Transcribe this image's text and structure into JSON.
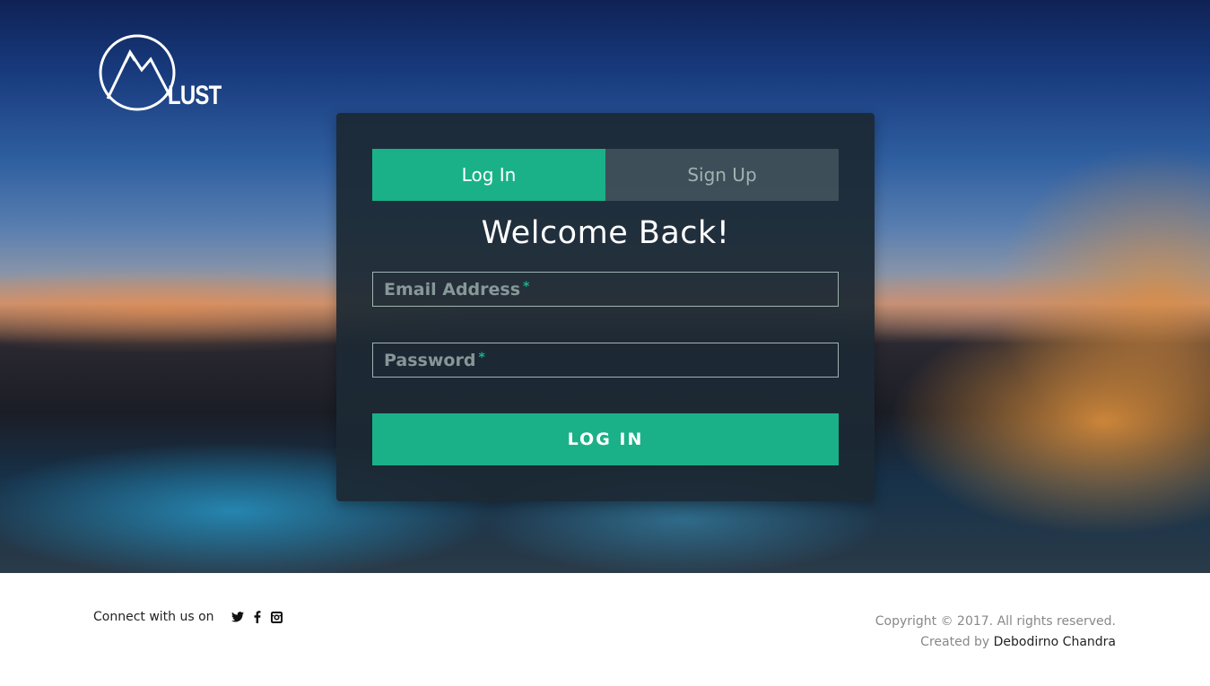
{
  "brand": {
    "logo_text": "LUST",
    "logo_icon": "mountain-circle-icon"
  },
  "tabs": [
    {
      "label": "Log In",
      "active": true
    },
    {
      "label": "Sign Up",
      "active": false
    }
  ],
  "form": {
    "heading": "Welcome Back!",
    "email": {
      "placeholder": "Email Address",
      "required_mark": "*",
      "value": ""
    },
    "password": {
      "placeholder": "Password",
      "required_mark": "*",
      "value": ""
    },
    "submit_label": "LOG IN"
  },
  "footer": {
    "connect_text": "Connect with us on",
    "social": [
      {
        "icon": "twitter-icon"
      },
      {
        "icon": "facebook-icon"
      },
      {
        "icon": "instagram-icon"
      }
    ],
    "copyright": "Copyright © 2017. All rights reserved.",
    "created_by_prefix": "Created by",
    "author": "Debodirno Chandra"
  },
  "colors": {
    "accent": "#1ab188",
    "panel": "#1c2934",
    "inactive_tab_text": "#a0b3b0"
  }
}
